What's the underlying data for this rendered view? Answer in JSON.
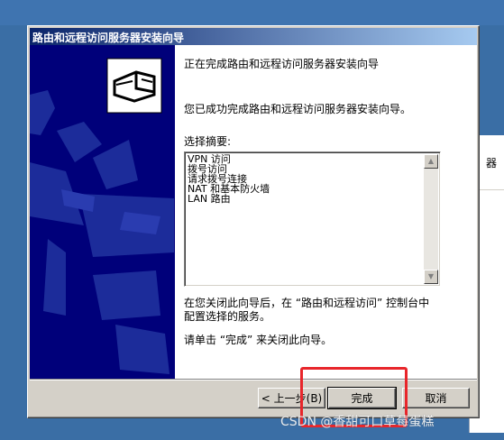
{
  "window": {
    "title": "路由和远程访问服务器安装向导"
  },
  "main": {
    "heading": "正在完成路由和远程访问服务器安装向导",
    "success_text": "您已成功完成路由和远程访问服务器安装向导。",
    "summary_label": "选择摘要:",
    "summary_items": [
      "VPN 访问",
      "拨号访问",
      "请求拨号连接",
      "NAT 和基本防火墙",
      "LAN 路由"
    ],
    "after_close_line1": "在您关闭此向导后，在 “路由和远程访问” 控制台中",
    "after_close_line2": "配置选择的服务。",
    "finish_prompt": "请单击 “完成” 来关闭此向导。"
  },
  "buttons": {
    "back": "< 上一步(B)",
    "finish": "完成",
    "cancel": "取消"
  },
  "background": {
    "partial_text": "器"
  },
  "watermark": "CSDN @香甜可口草莓蛋糕",
  "colors": {
    "titlebar_start": "#0a246a",
    "titlebar_end": "#a6caf0",
    "side_panel": "#00007a",
    "highlight": "#e8262b"
  }
}
